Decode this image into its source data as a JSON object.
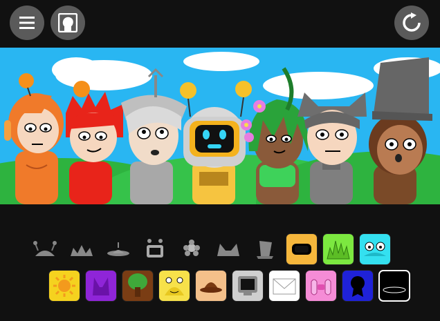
{
  "toolbar": {
    "menu_icon": "hamburger-icon",
    "profile_icon": "head-silhouette-icon",
    "reset_icon": "reset-icon"
  },
  "stage": {
    "sky_color": "#29b6f2",
    "characters": [
      {
        "name": "orange-headphones",
        "hair": "#f07a2a",
        "skin": "#f6d7bf",
        "shirt": "#f07a2a"
      },
      {
        "name": "red-spiky",
        "hair": "#e8241a",
        "skin": "#f6d7bf",
        "shirt": "#e8241a"
      },
      {
        "name": "silver-antenna",
        "hair": "#cfcfcf",
        "skin": "#f1dcc9",
        "shirt": "#a8a8a8"
      },
      {
        "name": "robot-helmet",
        "hair": "#d9d9d9",
        "skin": "#f1dcc9",
        "shirt": "#f6c440"
      },
      {
        "name": "plant-hair",
        "hair": "#2aa33a",
        "skin": "#8a5a3a",
        "shirt": "#3ed25a"
      },
      {
        "name": "cat-ears-gray",
        "hair": "#666666",
        "skin": "#f6d7bf",
        "shirt": "#7f7f7f"
      },
      {
        "name": "bucket-hat",
        "hair": "#6b3b1f",
        "skin": "#b97b52",
        "shirt": "#7a4a28"
      }
    ]
  },
  "palette": {
    "row1": [
      {
        "icon": "antenna-bulbs-icon",
        "active": false,
        "color": ""
      },
      {
        "icon": "spiky-crown-icon",
        "active": false,
        "color": ""
      },
      {
        "icon": "saucer-icon",
        "active": false,
        "color": ""
      },
      {
        "icon": "screen-antenna-icon",
        "active": false,
        "color": ""
      },
      {
        "icon": "flower-hair-icon",
        "active": false,
        "color": ""
      },
      {
        "icon": "cat-ears-icon",
        "active": false,
        "color": ""
      },
      {
        "icon": "bucket-icon",
        "active": false,
        "color": ""
      },
      {
        "icon": "visor-icon",
        "active": true,
        "color": "#f6b73c"
      },
      {
        "icon": "grass-spikes-icon",
        "active": true,
        "color": "#7ce840"
      },
      {
        "icon": "frog-eyes-icon",
        "active": true,
        "color": "#34e0f0"
      }
    ],
    "row2": [
      {
        "icon": "sun-icon",
        "active": true,
        "color": "#f5d21f"
      },
      {
        "icon": "purple-horns-icon",
        "active": true,
        "color": "#8f25d8"
      },
      {
        "icon": "tree-icon",
        "active": true,
        "color": "#7a3d14"
      },
      {
        "icon": "yellow-critter-icon",
        "active": true,
        "color": "#f7e14a"
      },
      {
        "icon": "brown-hat-icon",
        "active": true,
        "color": "#f4c08a"
      },
      {
        "icon": "monitor-icon",
        "active": true,
        "color": "#cfcfcf"
      },
      {
        "icon": "envelope-icon",
        "active": true,
        "color": "#ffffff"
      },
      {
        "icon": "pink-bow-icon",
        "active": true,
        "color": "#f58cd6"
      },
      {
        "icon": "blue-medal-icon",
        "active": true,
        "color": "#1f22d8"
      },
      {
        "icon": "black-hat-icon",
        "active": true,
        "color": "#000000"
      }
    ]
  }
}
